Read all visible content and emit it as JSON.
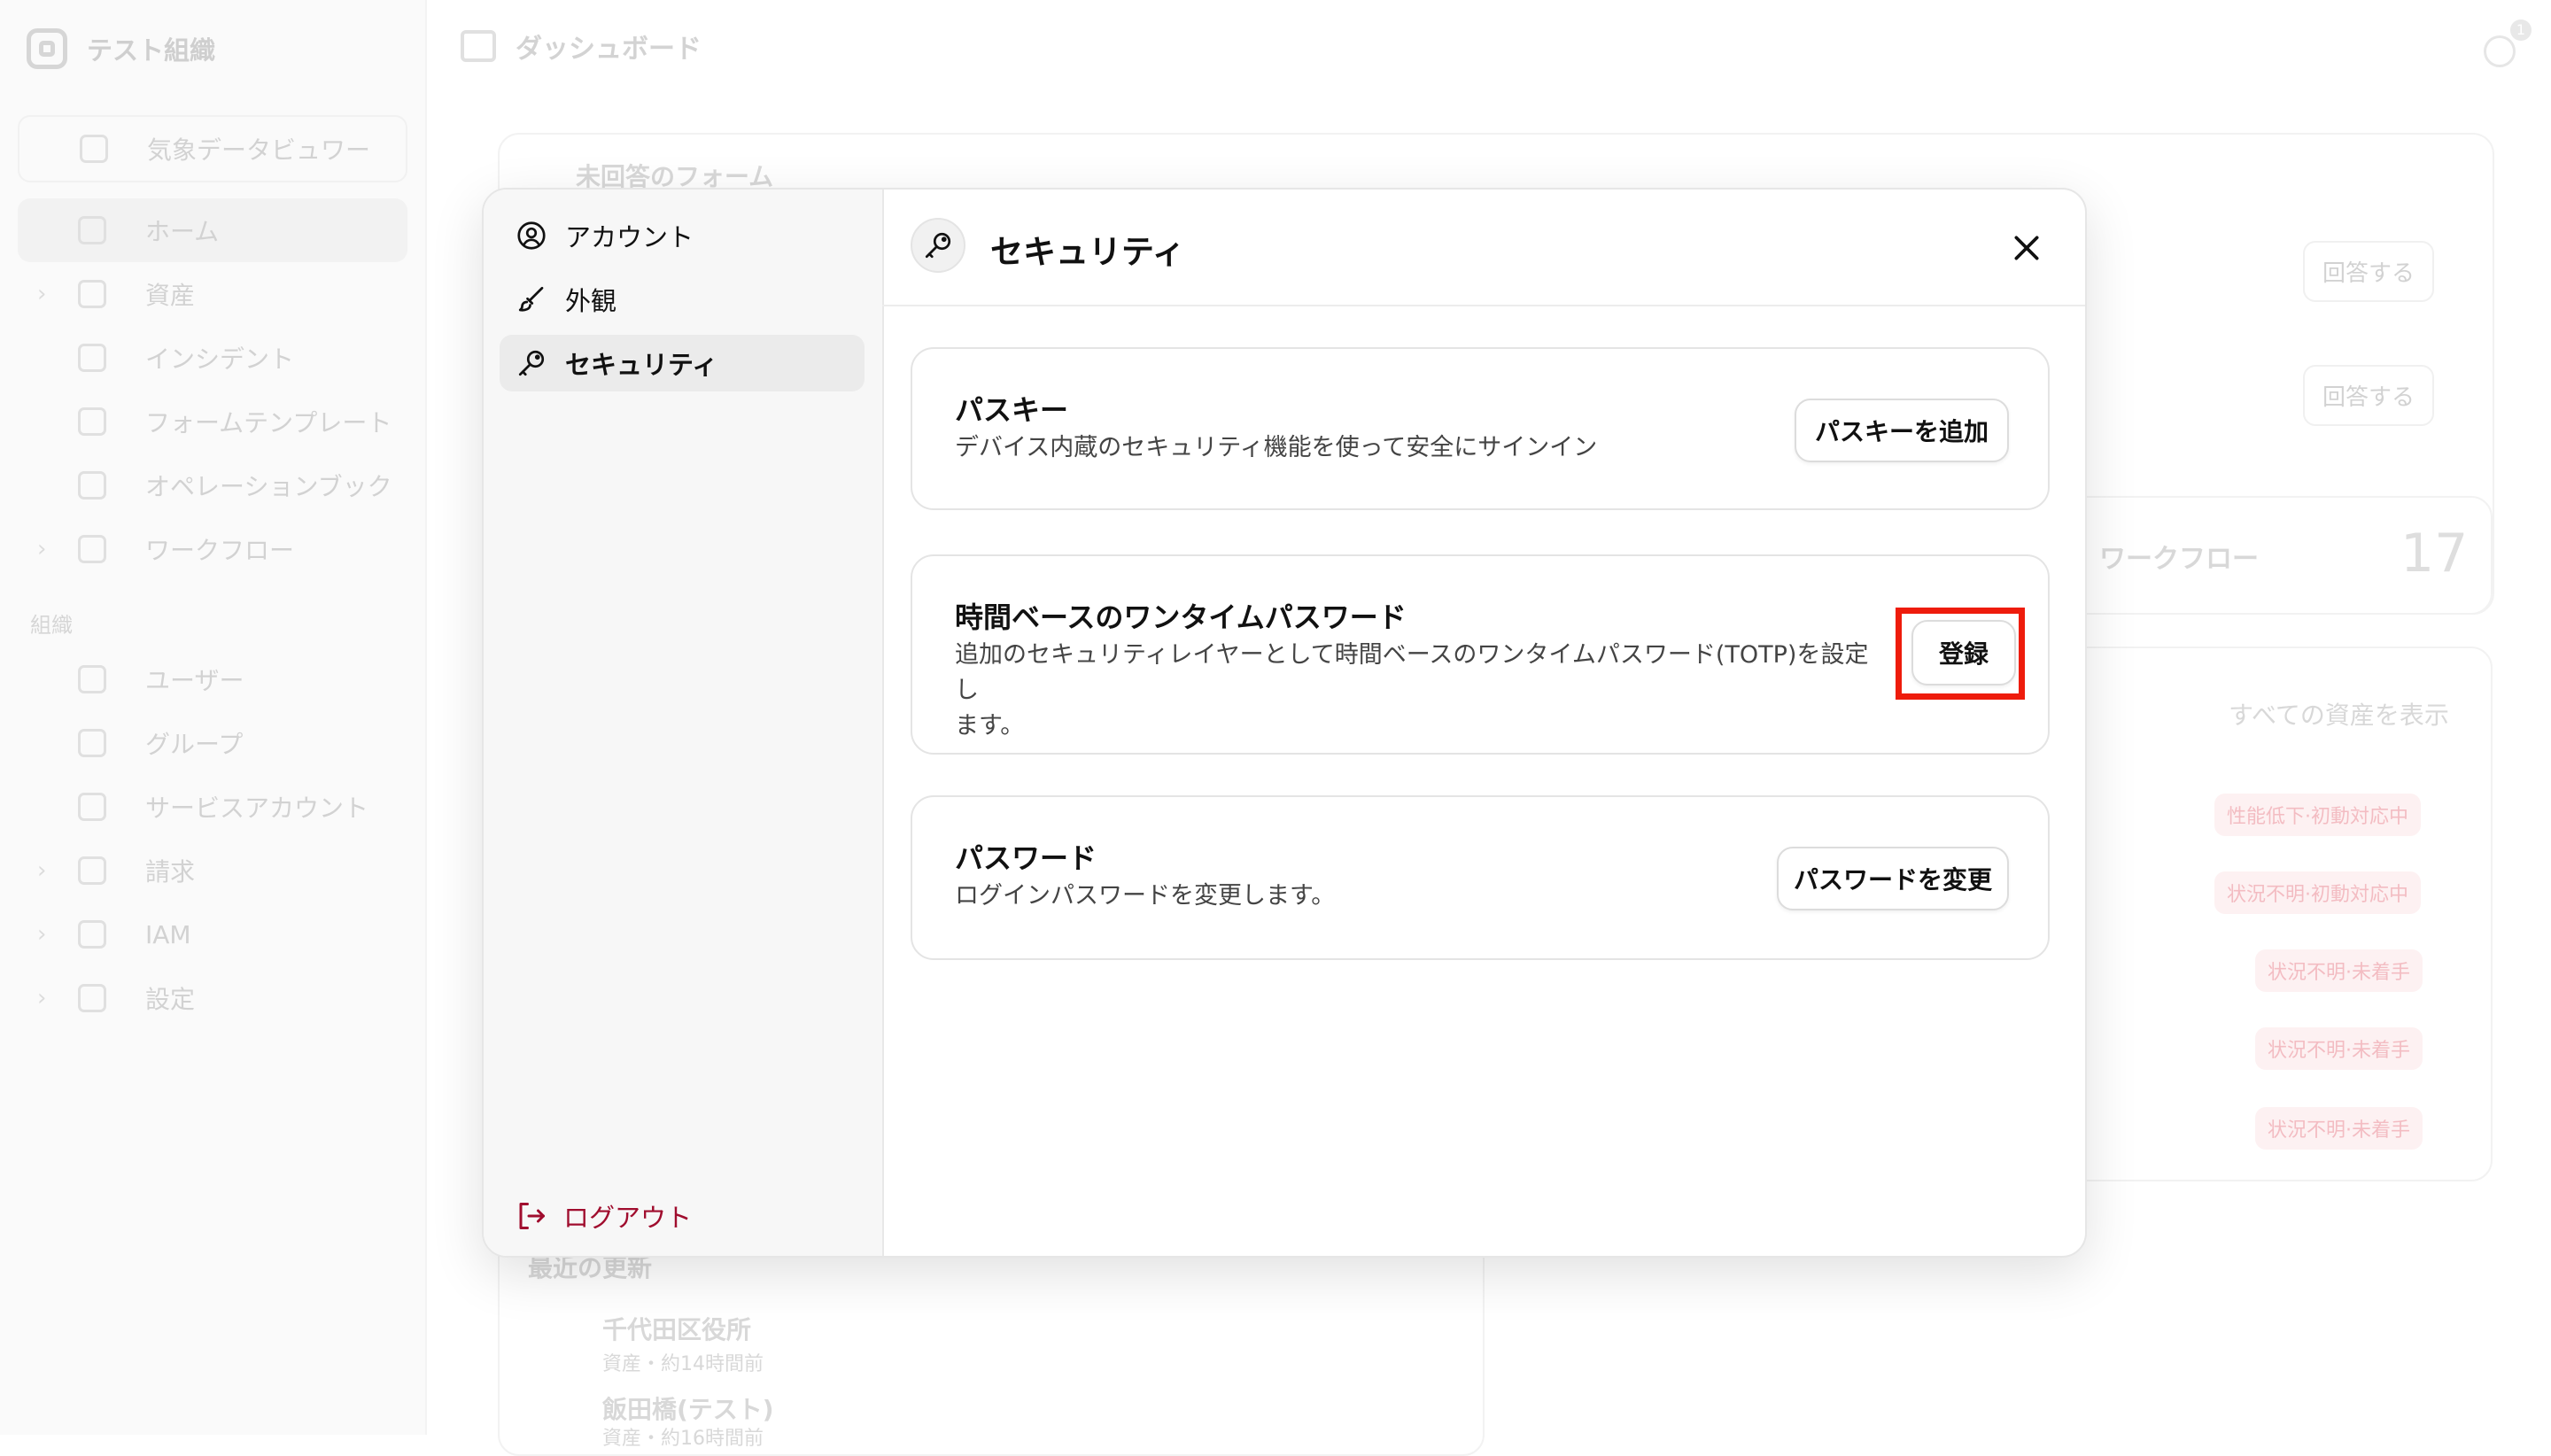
{
  "background": {
    "org_name": "テスト組織",
    "page_title": "ダッシュボード",
    "notification_count": "1",
    "nav": {
      "viewer": "気象データビュワー",
      "home": "ホーム",
      "assets": "資産",
      "incidents": "インシデント",
      "form_templates": "フォームテンプレート",
      "operation_book": "オペレーションブック",
      "workflow": "ワークフロー",
      "section_org": "組織",
      "users": "ユーザー",
      "groups": "グループ",
      "service_accounts": "サービスアカウント",
      "billing": "請求",
      "iam": "IAM",
      "settings": "設定"
    },
    "unanswered_forms_title": "未回答のフォーム",
    "answer_label_1": "回答する",
    "answer_label_2": "回答する",
    "workflow_label": "ワークフロー",
    "workflow_count": "17",
    "show_all_assets": "すべての資産を表示",
    "status_pills": [
      "性能低下·初動対応中",
      "状況不明·初動対応中",
      "状況不明·未着手",
      "状況不明·未着手",
      "状況不明·未着手"
    ],
    "recent_updates_title": "最近の更新",
    "recent": [
      {
        "name": "千代田区役所",
        "meta": "資産・約14時間前"
      },
      {
        "name": "飯田橋(テスト)",
        "meta": "資産・約16時間前"
      }
    ]
  },
  "modal": {
    "nav": [
      {
        "label": "アカウント",
        "icon": "account-icon"
      },
      {
        "label": "外観",
        "icon": "brush-icon"
      },
      {
        "label": "セキュリティ",
        "icon": "key-icon"
      }
    ],
    "active_nav": "セキュリティ",
    "logout_label": "ログアウト",
    "title": "セキュリティ",
    "sections": {
      "passkey": {
        "title": "パスキー",
        "description": "デバイス内蔵のセキュリティ機能を使って安全にサインイン",
        "button": "パスキーを追加"
      },
      "totp": {
        "title": "時間ベースのワンタイムパスワード",
        "description_line1": "追加のセキュリティレイヤーとして時間ベースのワンタイムパスワード(TOTP)を設定し",
        "description_line2": "ます。",
        "button": "登録"
      },
      "password": {
        "title": "パスワード",
        "description": "ログインパスワードを変更します。",
        "button": "パスワードを変更"
      }
    }
  },
  "colors": {
    "highlight": "#ee1c0c",
    "logout": "#a00d2e"
  }
}
